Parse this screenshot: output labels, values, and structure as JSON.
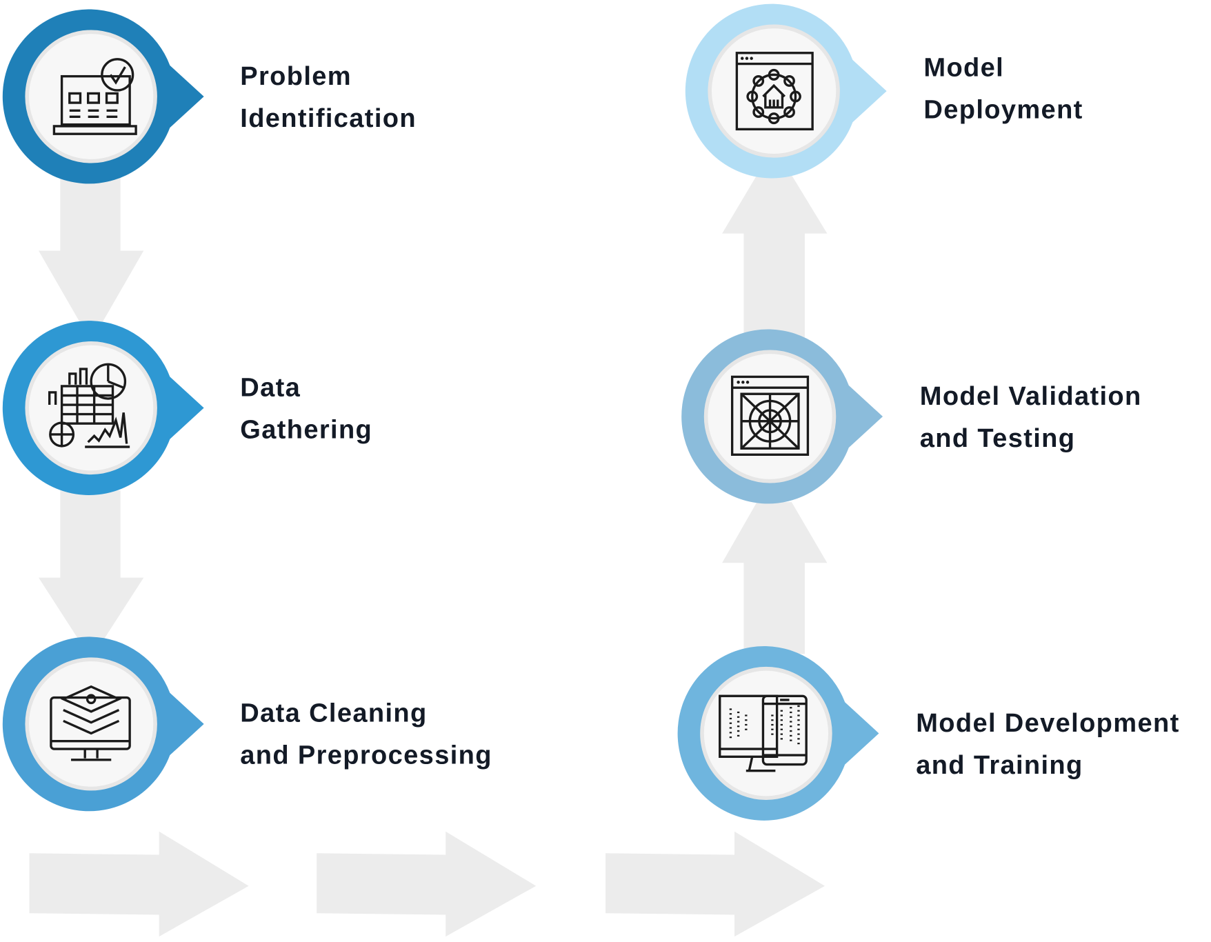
{
  "steps": [
    {
      "line1": "Problem",
      "line2": "Identification",
      "icon": "laptop-checklist-icon",
      "color": "#1f80b8"
    },
    {
      "line1": "Data",
      "line2": "Gathering",
      "icon": "data-charts-icon",
      "color": "#2e98d3"
    },
    {
      "line1": "Data Cleaning",
      "line2": "and Preprocessing",
      "icon": "monitor-layers-icon",
      "color": "#4aa0d5"
    },
    {
      "line1": "Model Development",
      "line2": "and Training",
      "icon": "devices-icon",
      "color": "#6fb5de"
    },
    {
      "line1": "Model Validation",
      "line2": "and Testing",
      "icon": "target-window-icon",
      "color": "#8bbcdb"
    },
    {
      "line1": "Model",
      "line2": "Deployment",
      "icon": "network-window-icon",
      "color": "#b2def5"
    }
  ],
  "arrow_color": "#ececec"
}
